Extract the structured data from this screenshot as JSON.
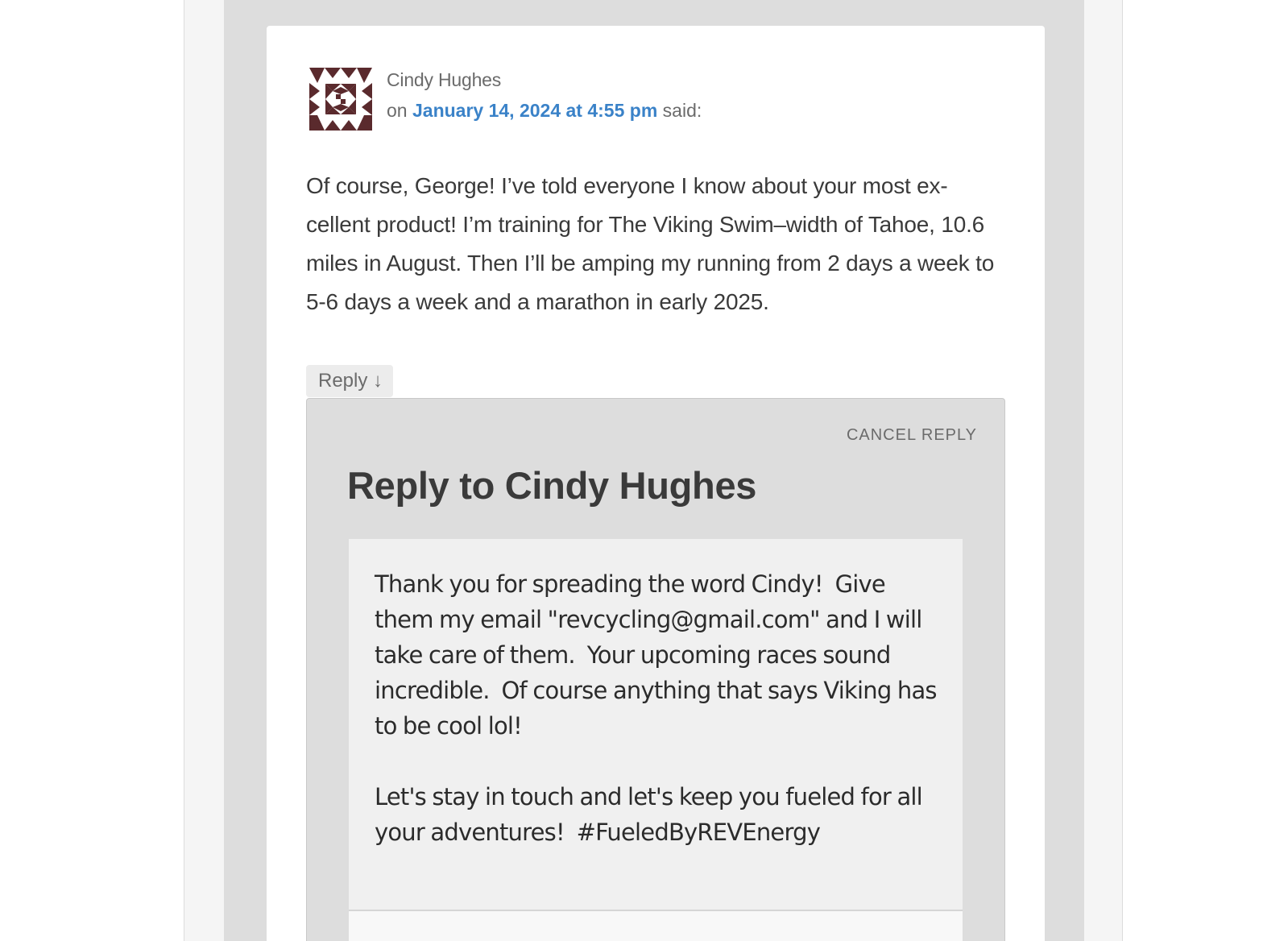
{
  "comment": {
    "author": "Cindy Hughes",
    "meta_prefix": "on",
    "date_link": "January 14, 2024 at 4:55 pm",
    "meta_suffix": "said:",
    "body": "Of course, George! I’ve told everyone I know about your most ex-cellent product! I’m training for The Viking Swim–width of Tahoe, 10.6 miles in August. Then I’ll be amping my running from 2 days a week to 5-6 days a week and a marathon in early 2025.",
    "reply_label": "Reply ↓"
  },
  "respond": {
    "cancel_label": "CANCEL REPLY",
    "title": "Reply to Cindy Hughes",
    "textarea_value": "Thank you for spreading the word Cindy!  Give them my email \"revcycling@gmail.com\" and I will take care of them.  Your upcoming races sound incredible.  Of course anything that says Viking has to be cool lol!\n\nLet's stay in touch and let's keep you fueled for all your adventures!  #FueledByREVEnergy"
  },
  "colors": {
    "link": "#3a82c8",
    "avatar": "#5a2a2d",
    "panel_gray": "#dddddd",
    "textarea_bg": "#f0f0f0"
  },
  "icons": {
    "avatar": "identicon-avatar",
    "reply_arrow": "down-arrow"
  }
}
